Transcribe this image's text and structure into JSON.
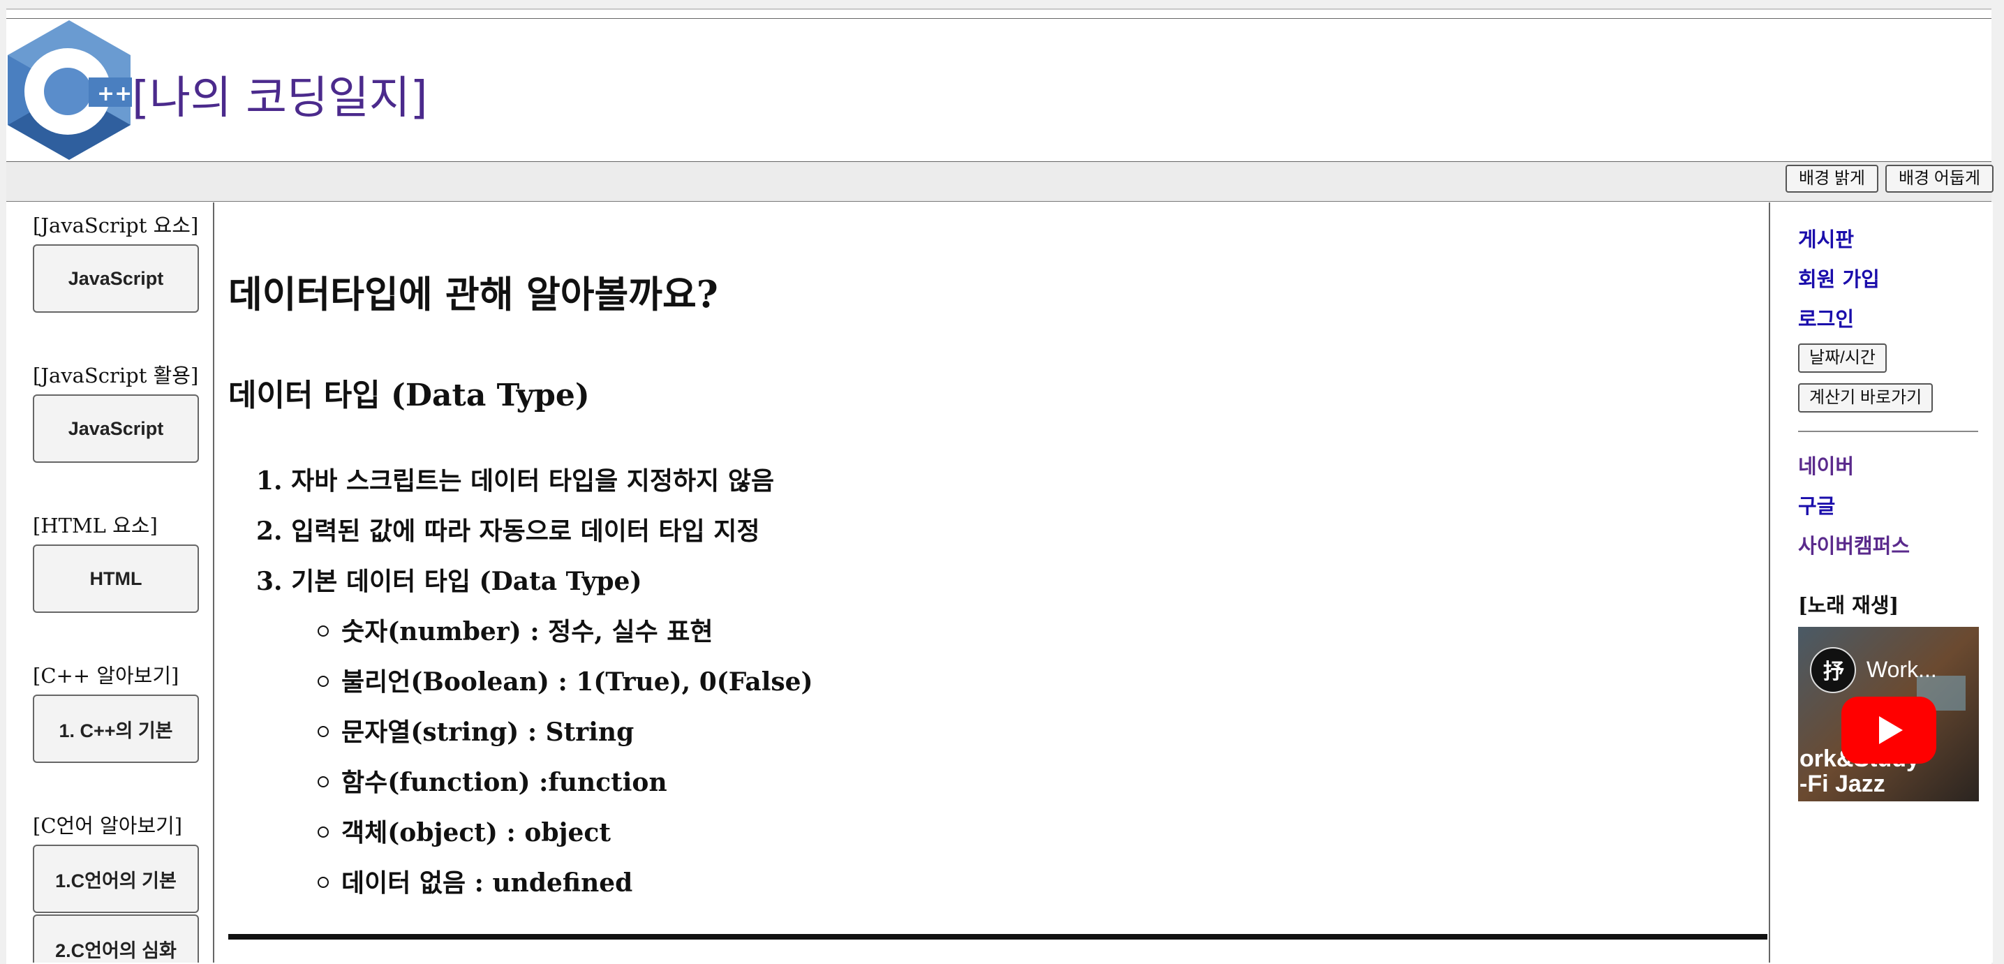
{
  "header": {
    "title": "[나의 코딩일지]",
    "logo_text": "++"
  },
  "toolbar": {
    "light_label": "배경 밝게",
    "dark_label": "배경 어둡게"
  },
  "left_sidebar": {
    "sections": [
      {
        "label": "[JavaScript 요소]",
        "buttons": [
          "JavaScript"
        ]
      },
      {
        "label": "[JavaScript 활용]",
        "buttons": [
          "JavaScript"
        ]
      },
      {
        "label": "[HTML 요소]",
        "buttons": [
          "HTML"
        ]
      },
      {
        "label": "[C++ 알아보기]",
        "buttons": [
          "1. C++의 기본"
        ]
      },
      {
        "label": "[C언어 알아보기]",
        "buttons": [
          "1.C언어의 기본",
          "2.C언어의 심화"
        ]
      }
    ]
  },
  "main": {
    "heading": "데이터타입에 관해 알아볼까요?",
    "subheading": "데이터 타입 (Data Type)",
    "ordered_items": [
      "1. 자바 스크립트는 데이터 타입을 지정하지 않음",
      "2. 입력된 값에 따라 자동으로 데이터 타입 지정",
      "3. 기본 데이터 타입 (Data Type)"
    ],
    "bullet_items": [
      "숫자(number) : 정수, 실수 표현",
      "불리언(Boolean) : 1(True), 0(False)",
      "문자열(string) : String",
      "함수(function) :function",
      "객체(object) : object",
      "데이터 없음 : undefined"
    ]
  },
  "right_sidebar": {
    "links": [
      "게시판",
      "회원 가입",
      "로그인"
    ],
    "buttons": [
      "날짜/시간",
      "계산기 바로가기"
    ],
    "external_links": [
      "네이버",
      "구글",
      "사이버캠퍼스"
    ],
    "music_label": "[노래 재생]",
    "video": {
      "title": "Work...",
      "overlay_line1": "ork&Study",
      "overlay_line2": "-Fi Jazz",
      "channel_badge": "抒"
    }
  },
  "colors": {
    "title": "#4b2a8c",
    "link_blue": "#1a0dab",
    "link_visited": "#5a2a8c",
    "youtube_red": "#ff0000"
  }
}
